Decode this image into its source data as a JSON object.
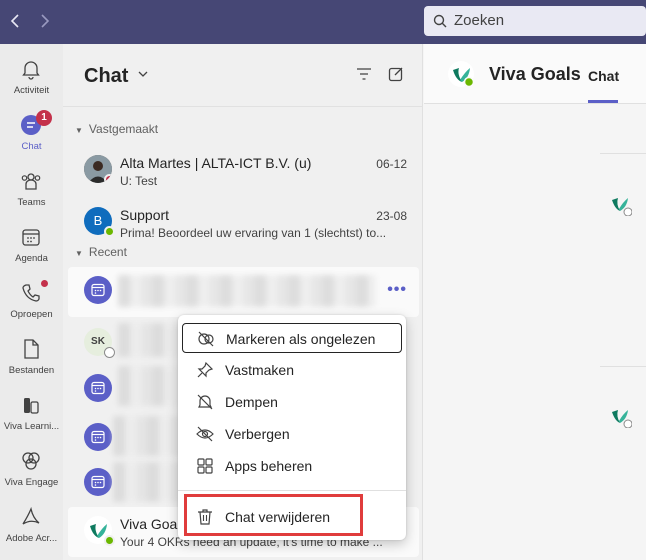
{
  "titlebar": {
    "back_icon": "chevron-left-icon",
    "forward_icon": "chevron-right-icon",
    "search_placeholder": "Zoeken"
  },
  "rail": {
    "items": [
      {
        "label": "Activiteit",
        "icon": "bell-icon"
      },
      {
        "label": "Chat",
        "icon": "chat-icon",
        "badge": "1",
        "active": true
      },
      {
        "label": "Teams",
        "icon": "teams-icon"
      },
      {
        "label": "Agenda",
        "icon": "calendar-icon"
      },
      {
        "label": "Oproepen",
        "icon": "phone-icon"
      },
      {
        "label": "Bestanden",
        "icon": "file-icon"
      },
      {
        "label": "Viva Learni...",
        "icon": "viva-learning-icon"
      },
      {
        "label": "Viva Engage",
        "icon": "viva-engage-icon"
      },
      {
        "label": "Adobe Acr...",
        "icon": "adobe-acrobat-icon"
      }
    ]
  },
  "chatlist": {
    "title": "Chat",
    "pinned_label": "Vastgemaakt",
    "recent_label": "Recent",
    "pinned": [
      {
        "name": "Alta Martes | ALTA-ICT B.V. (u)",
        "preview": "U: Test",
        "date": "06-12"
      },
      {
        "name": "Support",
        "preview": "Prima! Beoordeel uw ervaring van 1 (slechtst) to...",
        "date": "23-08",
        "initial": "B"
      }
    ],
    "recent_initials": "SK",
    "last": {
      "name": "Viva Goals",
      "preview": "Your 4 OKRs need an update, it's time to make ..."
    }
  },
  "menu": {
    "items": [
      {
        "label": "Markeren als ongelezen",
        "icon": "mark-unread-icon"
      },
      {
        "label": "Vastmaken",
        "icon": "pin-icon"
      },
      {
        "label": "Dempen",
        "icon": "mute-bell-icon"
      },
      {
        "label": "Verbergen",
        "icon": "hide-eye-icon"
      },
      {
        "label": "Apps beheren",
        "icon": "apps-grid-icon"
      },
      {
        "label": "Chat verwijderen",
        "icon": "trash-icon"
      }
    ]
  },
  "conversation": {
    "name": "Viva Goals",
    "tab": "Chat"
  },
  "colors": {
    "titlebar": "#464775",
    "accent": "#5b5fc7",
    "highlight_box": "#e03c3c",
    "badge": "#c4314b"
  }
}
